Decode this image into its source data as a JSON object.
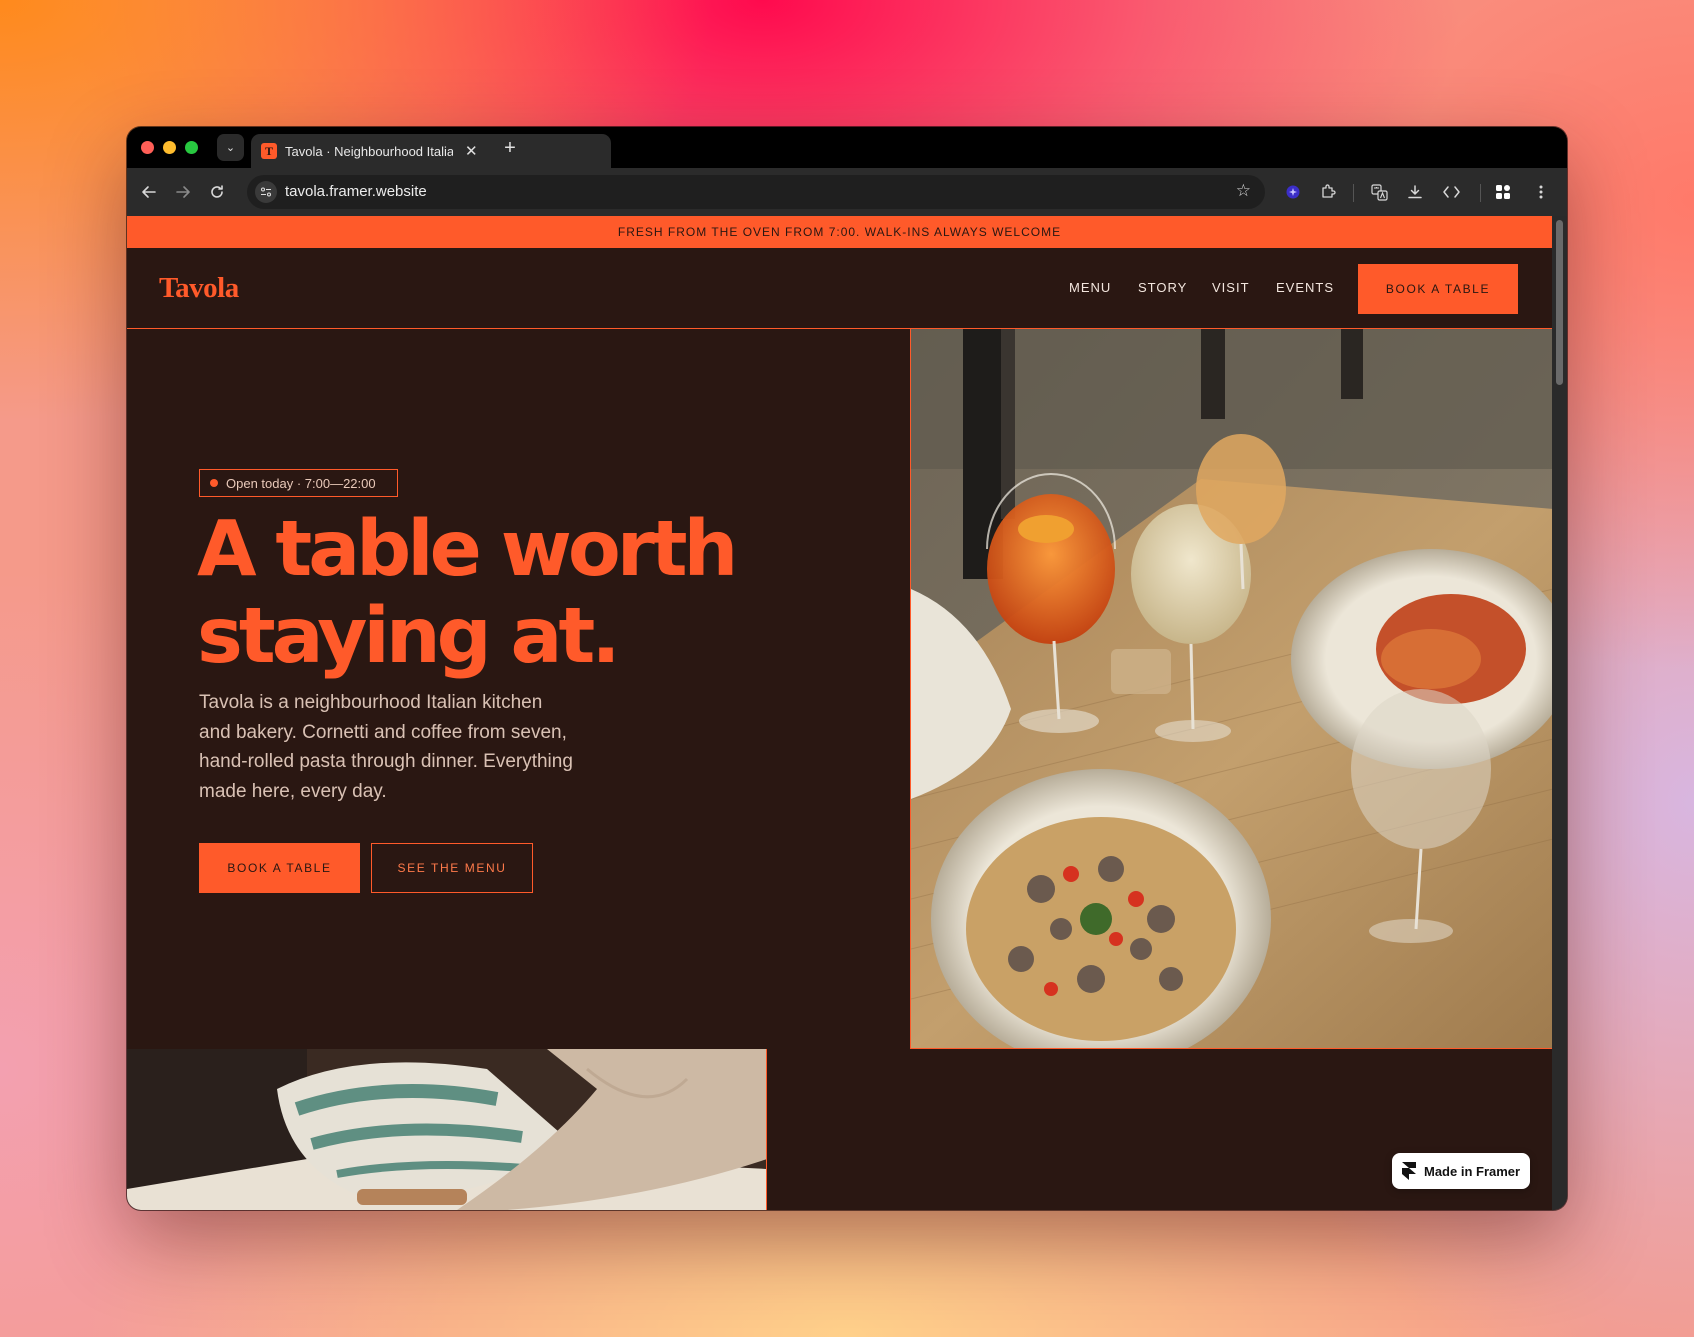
{
  "browser": {
    "tab_title": "Tavola · Neighbourhood Italian",
    "tab_favicon_letter": "T",
    "url": "tavola.framer.website",
    "icons": {
      "back": "back-arrow-icon",
      "forward": "forward-arrow-icon",
      "reload": "reload-icon",
      "bookmark": "star-icon",
      "extensions": "puzzle-icon",
      "translate": "translate-icon",
      "download": "download-icon",
      "devtools": "code-icon",
      "profile": "grid-icon",
      "menu": "more-vertical-icon"
    }
  },
  "announcement": "FRESH FROM THE OVEN FROM 7:00. WALK-INS ALWAYS WELCOME",
  "nav": {
    "logo": "Tavola",
    "links": [
      "MENU",
      "STORY",
      "VISIT",
      "EVENTS"
    ],
    "cta": "BOOK A TABLE"
  },
  "hero": {
    "badge": "Open today · 7:00—22:00",
    "headline_line1": "A table worth",
    "headline_line2": "staying at.",
    "intro": "Tavola is a neighbourhood Italian kitchen and bakery. Cornetti and coffee from seven, hand-rolled pasta through dinner. Everything made here, every day.",
    "primary_button": "BOOK A TABLE",
    "secondary_button": "SEE THE MENU"
  },
  "framer_badge": "Made in Framer",
  "colors": {
    "accent": "#ff5a2a",
    "page_bg": "#2a1712",
    "text_muted": "#d9c1b4"
  }
}
